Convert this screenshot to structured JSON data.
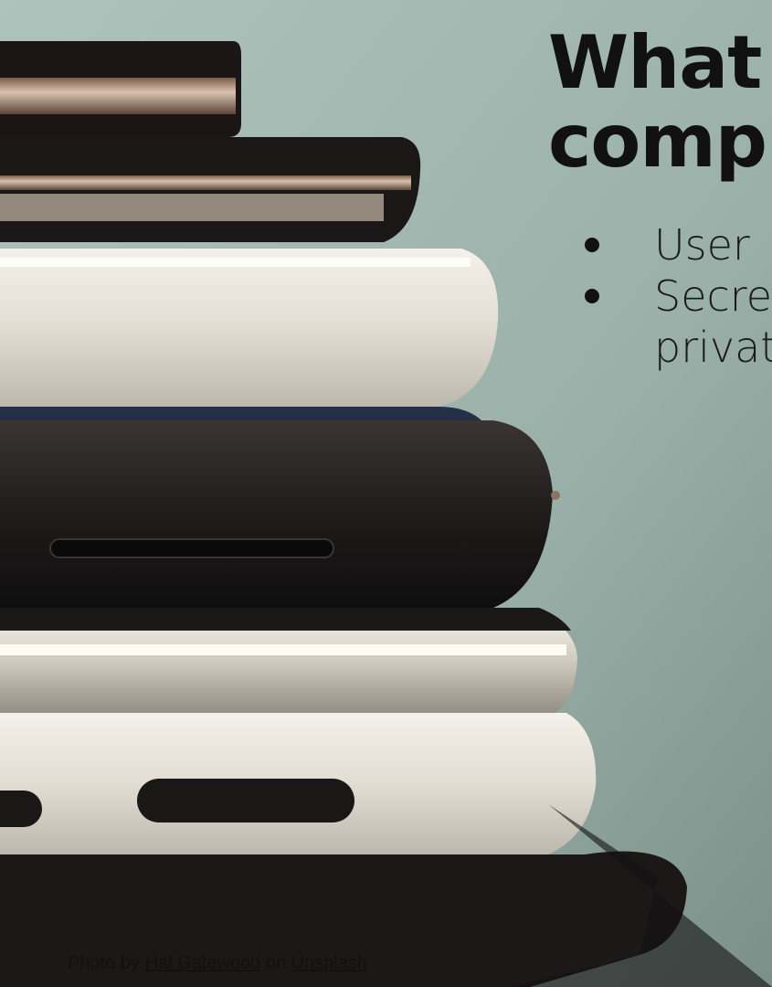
{
  "slide": {
    "title_line1": "What",
    "title_line2": "comp",
    "bullets": [
      {
        "line1": "User"
      },
      {
        "line1": "Secre",
        "line2": "privat"
      }
    ],
    "credit": {
      "prefix": "Photo by ",
      "author": "Hal Gatewood",
      "middle": " on ",
      "site": "Unsplash"
    }
  }
}
